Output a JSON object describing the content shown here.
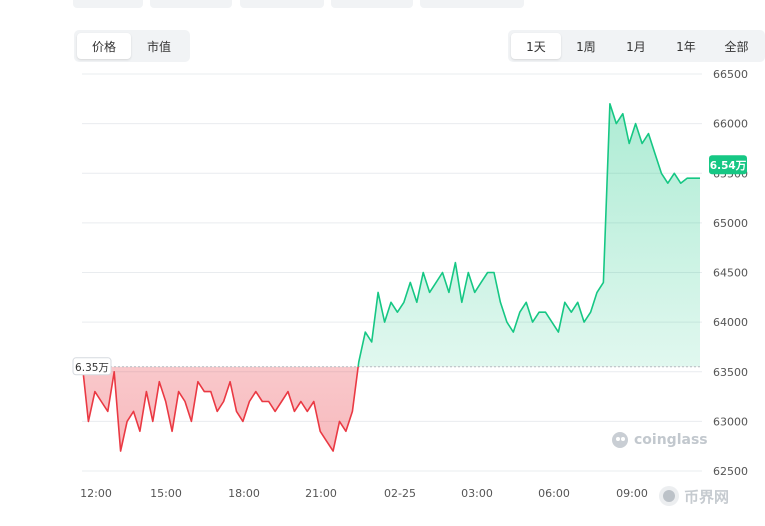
{
  "tabs": {
    "metric": [
      {
        "label": "价格",
        "active": true
      },
      {
        "label": "市值",
        "active": false
      }
    ],
    "range": [
      {
        "label": "1天",
        "active": true
      },
      {
        "label": "1周",
        "active": false
      },
      {
        "label": "1月",
        "active": false
      },
      {
        "label": "1年",
        "active": false
      },
      {
        "label": "全部",
        "active": false
      }
    ]
  },
  "colors": {
    "up": "#16c784",
    "down": "#ea3943",
    "grid": "#e9ecef",
    "axis_text": "#555555"
  },
  "watermark": {
    "brand": "coinglass",
    "site": "币界网"
  },
  "chart_data": {
    "type": "area",
    "ylim": [
      62500,
      66500
    ],
    "y_ticks": [
      "66500",
      "66000",
      "65500",
      "65000",
      "64500",
      "64000",
      "63500",
      "63000",
      "62500"
    ],
    "x_ticks": [
      "12:00",
      "15:00",
      "18:00",
      "21:00",
      "02-25",
      "03:00",
      "06:00",
      "09:00"
    ],
    "baseline": {
      "value": 63550,
      "label": "6.35万"
    },
    "current": {
      "value": 65450,
      "label": "6.54万"
    },
    "x": [
      "11:30",
      "11:45",
      "12:00",
      "12:15",
      "12:30",
      "12:45",
      "13:00",
      "13:15",
      "13:30",
      "13:45",
      "14:00",
      "14:15",
      "14:30",
      "14:45",
      "15:00",
      "15:15",
      "15:30",
      "15:45",
      "16:00",
      "16:15",
      "16:30",
      "16:45",
      "17:00",
      "17:15",
      "17:30",
      "17:45",
      "18:00",
      "18:15",
      "18:30",
      "18:45",
      "19:00",
      "19:15",
      "19:30",
      "19:45",
      "20:00",
      "20:15",
      "20:30",
      "20:45",
      "21:00",
      "21:15",
      "21:30",
      "21:45",
      "22:00",
      "22:15",
      "22:30",
      "22:45",
      "23:00",
      "23:15",
      "23:30",
      "23:45",
      "00:00",
      "00:15",
      "00:30",
      "00:45",
      "01:00",
      "01:15",
      "01:30",
      "01:45",
      "02:00",
      "02:15",
      "02:30",
      "02:45",
      "03:00",
      "03:15",
      "03:30",
      "03:45",
      "04:00",
      "04:15",
      "04:30",
      "04:45",
      "05:00",
      "05:15",
      "05:30",
      "05:45",
      "06:00",
      "06:15",
      "06:30",
      "06:45",
      "07:00",
      "07:15",
      "07:30",
      "07:45",
      "08:00",
      "08:15",
      "08:30",
      "08:45",
      "09:00",
      "09:15",
      "09:30",
      "09:45",
      "10:00",
      "10:15",
      "10:30",
      "10:45",
      "11:00",
      "11:15",
      "11:30"
    ],
    "values": [
      63600,
      63000,
      63300,
      63200,
      63100,
      63500,
      62700,
      63000,
      63100,
      62900,
      63300,
      63000,
      63400,
      63200,
      62900,
      63300,
      63200,
      63000,
      63400,
      63300,
      63300,
      63100,
      63200,
      63400,
      63100,
      63000,
      63200,
      63300,
      63200,
      63200,
      63100,
      63200,
      63300,
      63100,
      63200,
      63100,
      63200,
      62900,
      62800,
      62700,
      63000,
      62900,
      63100,
      63600,
      63900,
      63800,
      64300,
      64000,
      64200,
      64100,
      64200,
      64400,
      64200,
      64500,
      64300,
      64400,
      64500,
      64300,
      64600,
      64200,
      64500,
      64300,
      64400,
      64500,
      64500,
      64200,
      64000,
      63900,
      64100,
      64200,
      64000,
      64100,
      64100,
      64000,
      63900,
      64200,
      64100,
      64200,
      64000,
      64100,
      64300,
      64400,
      66200,
      66000,
      66100,
      65800,
      66000,
      65800,
      65900,
      65700,
      65500,
      65400,
      65500,
      65400,
      65450,
      65450,
      65450
    ]
  }
}
